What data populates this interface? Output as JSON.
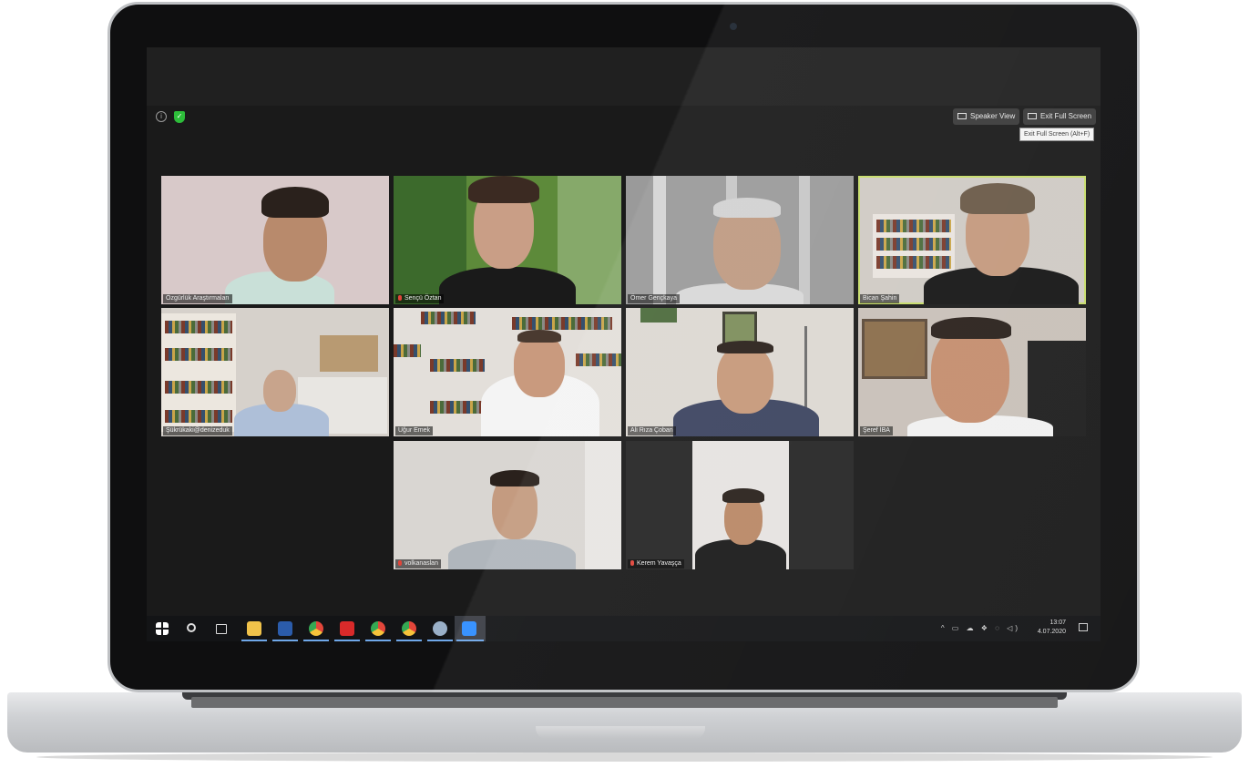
{
  "zoom": {
    "speaker_view_label": "Speaker View",
    "exit_full_screen_label": "Exit Full Screen",
    "exit_full_screen_tooltip": "Exit Full Screen (Alt+F)",
    "active_speaker_color": "#c7dc6a"
  },
  "participants": [
    {
      "name": "Özgürlük Araştırmaları",
      "muted": false
    },
    {
      "name": "Sençü Öztan",
      "muted": true
    },
    {
      "name": "Ömer Gençkaya",
      "muted": false
    },
    {
      "name": "Bican Şahin",
      "muted": false,
      "active_speaker": true
    },
    {
      "name": "Şükrükaki@denizeduk",
      "muted": false
    },
    {
      "name": "Uğur Emek",
      "muted": false
    },
    {
      "name": "Ali Rıza Çoban",
      "muted": false
    },
    {
      "name": "Şeref İBA",
      "muted": false
    },
    {
      "name": "volkanaslan",
      "muted": true
    },
    {
      "name": "Kerem Yavaşça",
      "muted": true
    }
  ],
  "taskbar": {
    "apps": [
      "windows-start",
      "search",
      "task-view",
      "file-explorer",
      "word",
      "chrome",
      "acrobat",
      "chrome",
      "chrome",
      "app",
      "zoom"
    ],
    "time": "13:07",
    "date": "4.07.2020"
  }
}
